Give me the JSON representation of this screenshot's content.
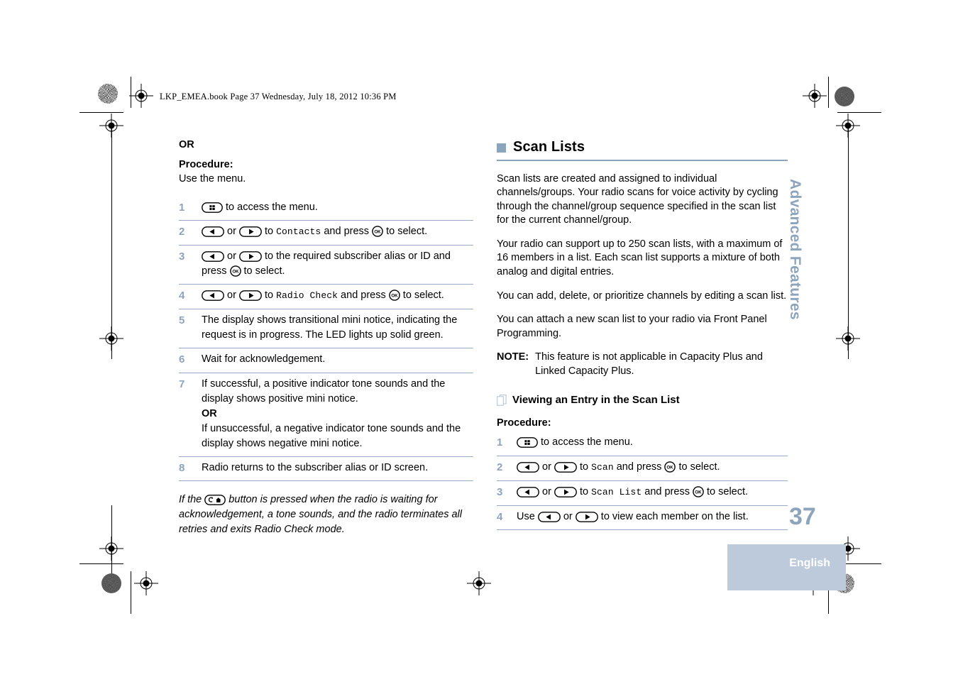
{
  "header": {
    "file_line": "LKP_EMEA.book  Page 37  Wednesday, July 18, 2012  10:36 PM"
  },
  "left_column": {
    "or_label": "OR",
    "procedure_label": "Procedure:",
    "procedure_intro": "Use the menu.",
    "steps": [
      {
        "number": "1",
        "parts": [
          {
            "type": "key",
            "icon": "menu-key-icon"
          },
          {
            "type": "text",
            "text": " to access the menu."
          }
        ]
      },
      {
        "number": "2",
        "parts": [
          {
            "type": "key",
            "icon": "left-arrow-key-icon"
          },
          {
            "type": "text",
            "text": " or "
          },
          {
            "type": "key",
            "icon": "right-arrow-key-icon"
          },
          {
            "type": "text",
            "text": " to "
          },
          {
            "type": "mono",
            "text": "Contacts"
          },
          {
            "type": "text",
            "text": " and press "
          },
          {
            "type": "key",
            "icon": "ok-key-icon"
          },
          {
            "type": "text",
            "text": " to select."
          }
        ]
      },
      {
        "number": "3",
        "parts": [
          {
            "type": "key",
            "icon": "left-arrow-key-icon"
          },
          {
            "type": "text",
            "text": " or "
          },
          {
            "type": "key",
            "icon": "right-arrow-key-icon"
          },
          {
            "type": "text",
            "text": " to the required subscriber alias or ID and press "
          },
          {
            "type": "key",
            "icon": "ok-key-icon"
          },
          {
            "type": "text",
            "text": " to select."
          }
        ]
      },
      {
        "number": "4",
        "parts": [
          {
            "type": "key",
            "icon": "left-arrow-key-icon"
          },
          {
            "type": "text",
            "text": " or "
          },
          {
            "type": "key",
            "icon": "right-arrow-key-icon"
          },
          {
            "type": "text",
            "text": " to "
          },
          {
            "type": "mono",
            "text": "Radio Check"
          },
          {
            "type": "text",
            "text": " and press "
          },
          {
            "type": "key",
            "icon": "ok-key-icon"
          },
          {
            "type": "text",
            "text": " to select."
          }
        ]
      },
      {
        "number": "5",
        "parts": [
          {
            "type": "text",
            "text": "The display shows transitional mini notice, indicating the request is in progress. The LED lights up solid green."
          }
        ]
      },
      {
        "number": "6",
        "parts": [
          {
            "type": "text",
            "text": "Wait for acknowledgement."
          }
        ]
      },
      {
        "number": "7",
        "parts": [
          {
            "type": "text",
            "text": "If successful, a positive indicator tone sounds and the display shows positive mini notice."
          },
          {
            "type": "break-bold",
            "text": "OR"
          },
          {
            "type": "text",
            "text": "If unsuccessful, a negative indicator tone sounds and the display shows negative mini notice."
          }
        ]
      },
      {
        "number": "8",
        "parts": [
          {
            "type": "text",
            "text": "Radio returns to the subscriber alias or ID screen."
          }
        ]
      }
    ],
    "italic_note": [
      {
        "type": "text",
        "text": "If the "
      },
      {
        "type": "key",
        "icon": "back-home-key-icon"
      },
      {
        "type": "text",
        "text": " button is pressed when the radio is waiting for acknowledgement, a tone sounds, and the radio terminates all retries and exits Radio Check mode."
      }
    ]
  },
  "right_column": {
    "heading": "Scan Lists",
    "paragraphs": [
      "Scan lists are created and assigned to individual channels/groups. Your radio scans for voice activity by cycling through the channel/group sequence specified in the scan list for the current channel/group.",
      "Your radio can support up to 250 scan lists, with a maximum of 16 members in a list. Each scan list supports a mixture of both analog and digital entries.",
      "You can add, delete, or prioritize channels by editing a scan list.",
      "You can attach a new scan list to your radio via Front Panel Programming."
    ],
    "note": {
      "label": "NOTE:",
      "text": "This feature is not applicable in Capacity Plus and Linked Capacity Plus."
    },
    "subheading": "Viewing an Entry in the Scan List",
    "procedure_label": "Procedure:",
    "steps": [
      {
        "number": "1",
        "parts": [
          {
            "type": "key",
            "icon": "menu-key-icon"
          },
          {
            "type": "text",
            "text": " to access the menu."
          }
        ]
      },
      {
        "number": "2",
        "parts": [
          {
            "type": "key",
            "icon": "left-arrow-key-icon"
          },
          {
            "type": "text",
            "text": " or "
          },
          {
            "type": "key",
            "icon": "right-arrow-key-icon"
          },
          {
            "type": "text",
            "text": " to "
          },
          {
            "type": "mono",
            "text": "Scan"
          },
          {
            "type": "text",
            "text": " and press "
          },
          {
            "type": "key",
            "icon": "ok-key-icon"
          },
          {
            "type": "text",
            "text": " to select."
          }
        ]
      },
      {
        "number": "3",
        "parts": [
          {
            "type": "key",
            "icon": "left-arrow-key-icon"
          },
          {
            "type": "text",
            "text": " or "
          },
          {
            "type": "key",
            "icon": "right-arrow-key-icon"
          },
          {
            "type": "text",
            "text": " to "
          },
          {
            "type": "mono",
            "text": "Scan List"
          },
          {
            "type": "text",
            "text": " and press "
          },
          {
            "type": "key",
            "icon": "ok-key-icon"
          },
          {
            "type": "text",
            "text": " to select."
          }
        ]
      },
      {
        "number": "4",
        "parts": [
          {
            "type": "text",
            "text": "Use "
          },
          {
            "type": "key",
            "icon": "left-arrow-key-icon"
          },
          {
            "type": "text",
            "text": " or "
          },
          {
            "type": "key",
            "icon": "right-arrow-key-icon"
          },
          {
            "type": "text",
            "text": " to view each member on the list."
          }
        ]
      }
    ]
  },
  "side_tab": "Advanced Features",
  "page_number": "37",
  "language": "English",
  "colors": {
    "accent_blue_gray": "#8da4bd",
    "rule_blue": "#97acc4",
    "language_block": "#bccadb"
  }
}
